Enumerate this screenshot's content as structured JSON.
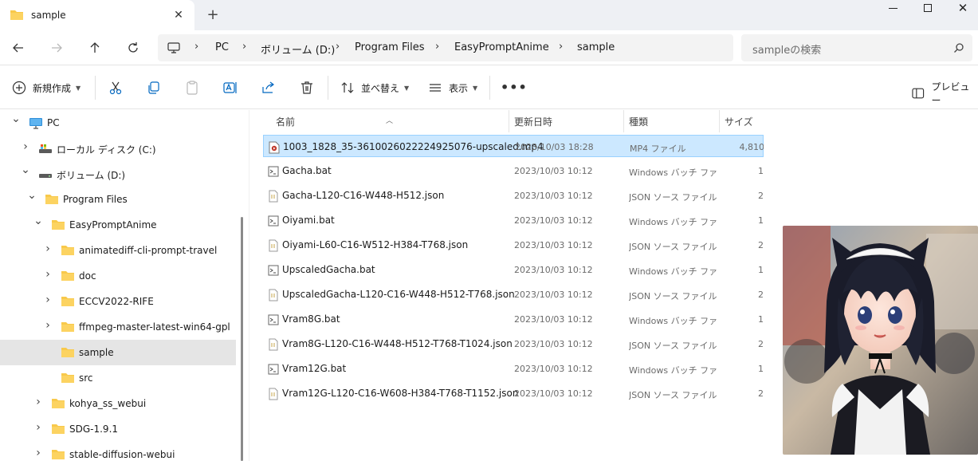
{
  "window": {
    "tab_title": "sample",
    "close_tab": "✕",
    "new_tab": "+",
    "close_window": "✕"
  },
  "address": {
    "crumbs": [
      "PC",
      "ボリューム (D:)",
      "Program Files",
      "EasyPromptAnime",
      "sample"
    ],
    "separator": "›",
    "search_placeholder": "sampleの検索"
  },
  "commands": {
    "new": "新規作成",
    "sort": "並べ替え",
    "view": "表示",
    "more": "•••",
    "preview": "プレビュー"
  },
  "icons": {
    "back": "arrow-left-icon",
    "forward": "arrow-right-icon",
    "up": "arrow-up-icon",
    "refresh": "refresh-icon",
    "cut": "scissors-icon",
    "copy": "copy-icon",
    "paste": "paste-icon",
    "rename": "rename-icon",
    "share": "share-icon",
    "delete": "trash-icon"
  },
  "nav_tree": [
    {
      "label": "PC",
      "chevron": "down",
      "icon": "monitor",
      "indent": 0
    },
    {
      "label": "ローカル ディスク (C:)",
      "chevron": "right",
      "icon": "drive-c",
      "indent": 1
    },
    {
      "label": "ボリューム (D:)",
      "chevron": "down",
      "icon": "drive",
      "indent": 1
    },
    {
      "label": "Program Files",
      "chevron": "down",
      "icon": "folder",
      "indent": 2
    },
    {
      "label": "EasyPromptAnime",
      "chevron": "down",
      "icon": "folder",
      "indent": 3
    },
    {
      "label": "animatediff-cli-prompt-travel",
      "chevron": "right",
      "icon": "folder",
      "indent": 4
    },
    {
      "label": "doc",
      "chevron": "right",
      "icon": "folder",
      "indent": 4
    },
    {
      "label": "ECCV2022-RIFE",
      "chevron": "right",
      "icon": "folder",
      "indent": 4
    },
    {
      "label": "ffmpeg-master-latest-win64-gpl",
      "chevron": "right",
      "icon": "folder",
      "indent": 4
    },
    {
      "label": "sample",
      "chevron": "",
      "icon": "folder",
      "indent": 4,
      "selected": true
    },
    {
      "label": "src",
      "chevron": "",
      "icon": "folder",
      "indent": 4
    },
    {
      "label": "kohya_ss_webui",
      "chevron": "right",
      "icon": "folder",
      "indent": 3
    },
    {
      "label": "SDG-1.9.1",
      "chevron": "right",
      "icon": "folder",
      "indent": 3
    },
    {
      "label": "stable-diffusion-webui",
      "chevron": "right",
      "icon": "folder",
      "indent": 3
    }
  ],
  "columns": {
    "name": "名前",
    "date": "更新日時",
    "type": "種類",
    "size": "サイズ"
  },
  "files": [
    {
      "name": "1003_1828_35-3610026022224925076-upscaled.mp4",
      "date": "2023/10/03 18:28",
      "type": "MP4 ファイル",
      "size": "4,810",
      "kind": "mp4",
      "selected": true
    },
    {
      "name": "Gacha.bat",
      "date": "2023/10/03 10:12",
      "type": "Windows バッチ ファ...",
      "size": "1",
      "kind": "bat"
    },
    {
      "name": "Gacha-L120-C16-W448-H512.json",
      "date": "2023/10/03 10:12",
      "type": "JSON ソース ファイル",
      "size": "2",
      "kind": "json"
    },
    {
      "name": "Oiyami.bat",
      "date": "2023/10/03 10:12",
      "type": "Windows バッチ ファ...",
      "size": "1",
      "kind": "bat"
    },
    {
      "name": "Oiyami-L60-C16-W512-H384-T768.json",
      "date": "2023/10/03 10:12",
      "type": "JSON ソース ファイル",
      "size": "2",
      "kind": "json"
    },
    {
      "name": "UpscaledGacha.bat",
      "date": "2023/10/03 10:12",
      "type": "Windows バッチ ファ...",
      "size": "1",
      "kind": "bat"
    },
    {
      "name": "UpscaledGacha-L120-C16-W448-H512-T768.json",
      "date": "2023/10/03 10:12",
      "type": "JSON ソース ファイル",
      "size": "2",
      "kind": "json"
    },
    {
      "name": "Vram8G.bat",
      "date": "2023/10/03 10:12",
      "type": "Windows バッチ ファ...",
      "size": "1",
      "kind": "bat"
    },
    {
      "name": "Vram8G-L120-C16-W448-H512-T768-T1024.json",
      "date": "2023/10/03 10:12",
      "type": "JSON ソース ファイル",
      "size": "2",
      "kind": "json"
    },
    {
      "name": "Vram12G.bat",
      "date": "2023/10/03 10:12",
      "type": "Windows バッチ ファ...",
      "size": "1",
      "kind": "bat"
    },
    {
      "name": "Vram12G-L120-C16-W608-H384-T768-T1152.json",
      "date": "2023/10/03 10:12",
      "type": "JSON ソース ファイル",
      "size": "2",
      "kind": "json"
    }
  ],
  "colors": {
    "selection": "#cce8ff",
    "folder": "#f8c94b",
    "accent": "#0067c0"
  }
}
